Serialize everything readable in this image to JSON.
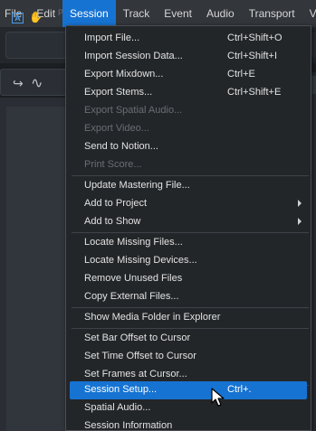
{
  "menubar": {
    "items": [
      {
        "label": "File"
      },
      {
        "label": "Edit"
      },
      {
        "label": "Session"
      },
      {
        "label": "Track"
      },
      {
        "label": "Event"
      },
      {
        "label": "Audio"
      },
      {
        "label": "Transport"
      },
      {
        "label": "Vie"
      }
    ],
    "active_index": 2
  },
  "toolbar": {
    "partial_text": "P"
  },
  "session_menu": {
    "groups": [
      [
        {
          "label": "Import File...",
          "shortcut": "Ctrl+Shift+O",
          "enabled": true
        },
        {
          "label": "Import Session Data...",
          "shortcut": "Ctrl+Shift+I",
          "enabled": true
        },
        {
          "label": "Export Mixdown...",
          "shortcut": "Ctrl+E",
          "enabled": true
        },
        {
          "label": "Export Stems...",
          "shortcut": "Ctrl+Shift+E",
          "enabled": true
        },
        {
          "label": "Export Spatial Audio...",
          "shortcut": "",
          "enabled": false
        },
        {
          "label": "Export Video...",
          "shortcut": "",
          "enabled": false
        },
        {
          "label": "Send to Notion...",
          "shortcut": "",
          "enabled": true
        },
        {
          "label": "Print Score...",
          "shortcut": "",
          "enabled": false
        }
      ],
      [
        {
          "label": "Update Mastering File...",
          "shortcut": "",
          "enabled": true
        },
        {
          "label": "Add to Project",
          "shortcut": "",
          "enabled": true,
          "submenu": true
        },
        {
          "label": "Add to Show",
          "shortcut": "",
          "enabled": true,
          "submenu": true
        }
      ],
      [
        {
          "label": "Locate Missing Files...",
          "shortcut": "",
          "enabled": true
        },
        {
          "label": "Locate Missing Devices...",
          "shortcut": "",
          "enabled": true
        },
        {
          "label": "Remove Unused Files",
          "shortcut": "",
          "enabled": true
        },
        {
          "label": "Copy External Files...",
          "shortcut": "",
          "enabled": true
        }
      ],
      [
        {
          "label": "Show Media Folder in Explorer",
          "shortcut": "",
          "enabled": true
        }
      ],
      [
        {
          "label": "Set Bar Offset to Cursor",
          "shortcut": "",
          "enabled": true
        },
        {
          "label": "Set Time Offset to Cursor",
          "shortcut": "",
          "enabled": true
        },
        {
          "label": "Set Frames at Cursor...",
          "shortcut": "",
          "enabled": true
        }
      ],
      [
        {
          "label": "Session Setup...",
          "shortcut": "Ctrl+.",
          "enabled": true,
          "highlighted": true
        },
        {
          "label": "Spatial Audio...",
          "shortcut": "",
          "enabled": true
        },
        {
          "label": "Session Information",
          "shortcut": "",
          "enabled": true
        }
      ]
    ]
  },
  "colors": {
    "accent": "#1673d2",
    "menu_bg": "#232629",
    "menubar_bg": "#33363b",
    "disabled_text": "#6a6e74"
  }
}
